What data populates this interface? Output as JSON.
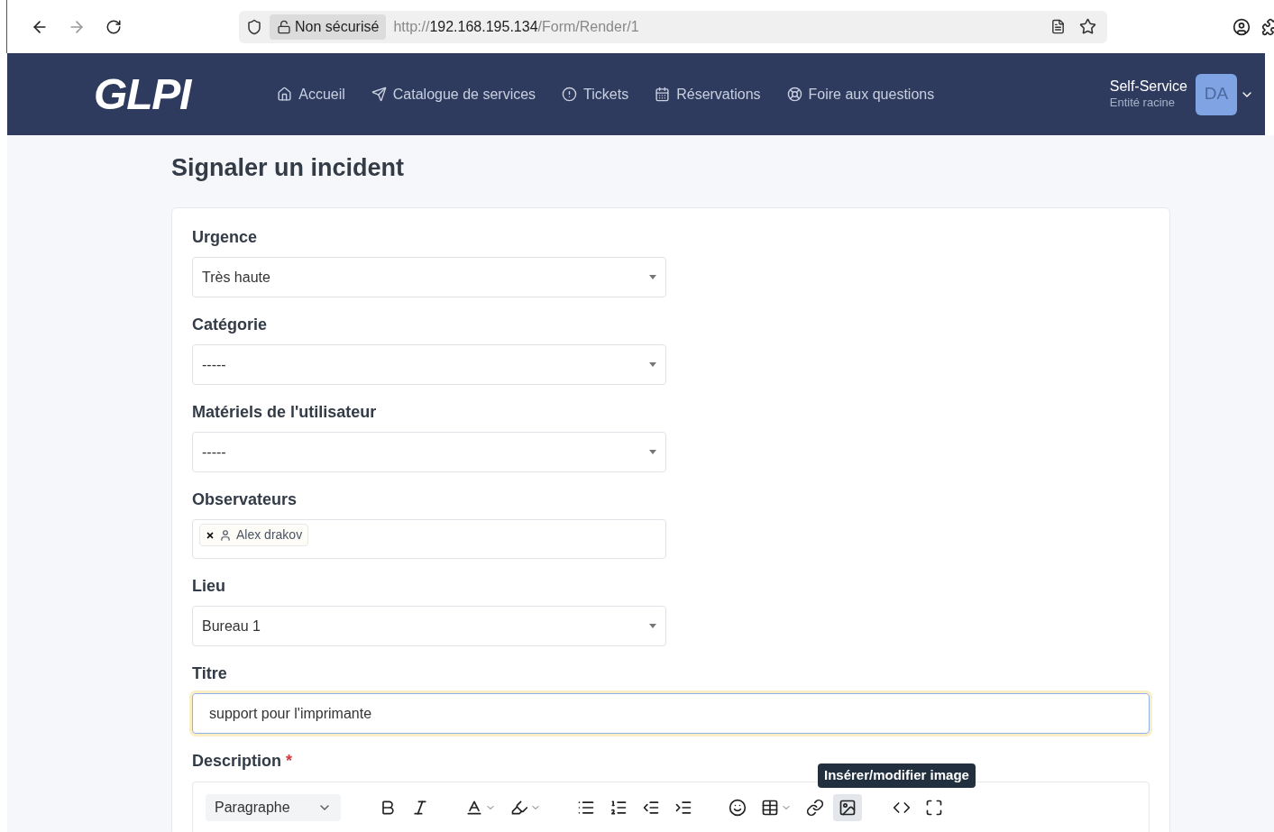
{
  "browser": {
    "security": "Non sécurisé",
    "url_scheme": "http://",
    "url_host": "192.168.195.134",
    "url_path": "/Form/Render/1"
  },
  "navbar": {
    "logo": "GLPI",
    "items": [
      {
        "label": "Accueil",
        "kind": "home"
      },
      {
        "label": "Catalogue de services",
        "kind": "send"
      },
      {
        "label": "Tickets",
        "kind": "alert"
      },
      {
        "label": "Réservations",
        "kind": "calendar"
      },
      {
        "label": "Foire aux questions",
        "kind": "lifebuoy"
      }
    ],
    "profile": {
      "name": "Self-Service",
      "entity": "Entité racine",
      "initials": "DA"
    }
  },
  "page_title": "Signaler un incident",
  "fields": [
    {
      "label": "Urgence",
      "kind": "select",
      "value": "Très haute"
    },
    {
      "label": "Catégorie",
      "kind": "select",
      "value": "-----"
    },
    {
      "label": "Matériels de l'utilisateur",
      "kind": "select",
      "value": "-----"
    },
    {
      "label": "Observateurs",
      "kind": "tags",
      "tags": [
        "Alex drakov"
      ]
    },
    {
      "label": "Lieu",
      "kind": "select",
      "value": "Bureau 1"
    },
    {
      "label": "Titre",
      "kind": "text",
      "value": "support pour l'imprimante",
      "focused": true
    }
  ],
  "description": {
    "label": "Description",
    "required_mark": "*",
    "editor": {
      "block_format": "Paragraphe",
      "tooltip": "Insérer/modifier image",
      "tools": [
        {
          "kind": "bold",
          "active": false
        },
        {
          "kind": "italic",
          "active": false
        },
        {
          "kind": "color",
          "active": false
        },
        {
          "kind": "highlight",
          "active": false
        },
        {
          "kind": "bullets",
          "active": false
        },
        {
          "kind": "numbers",
          "active": false
        },
        {
          "kind": "outdent",
          "active": false
        },
        {
          "kind": "indent",
          "active": false
        },
        {
          "kind": "emoji",
          "active": false
        },
        {
          "kind": "table",
          "active": false
        },
        {
          "kind": "link",
          "active": false
        },
        {
          "kind": "image",
          "active": true
        },
        {
          "kind": "code",
          "active": false
        },
        {
          "kind": "fullscreen",
          "active": false
        }
      ]
    }
  }
}
